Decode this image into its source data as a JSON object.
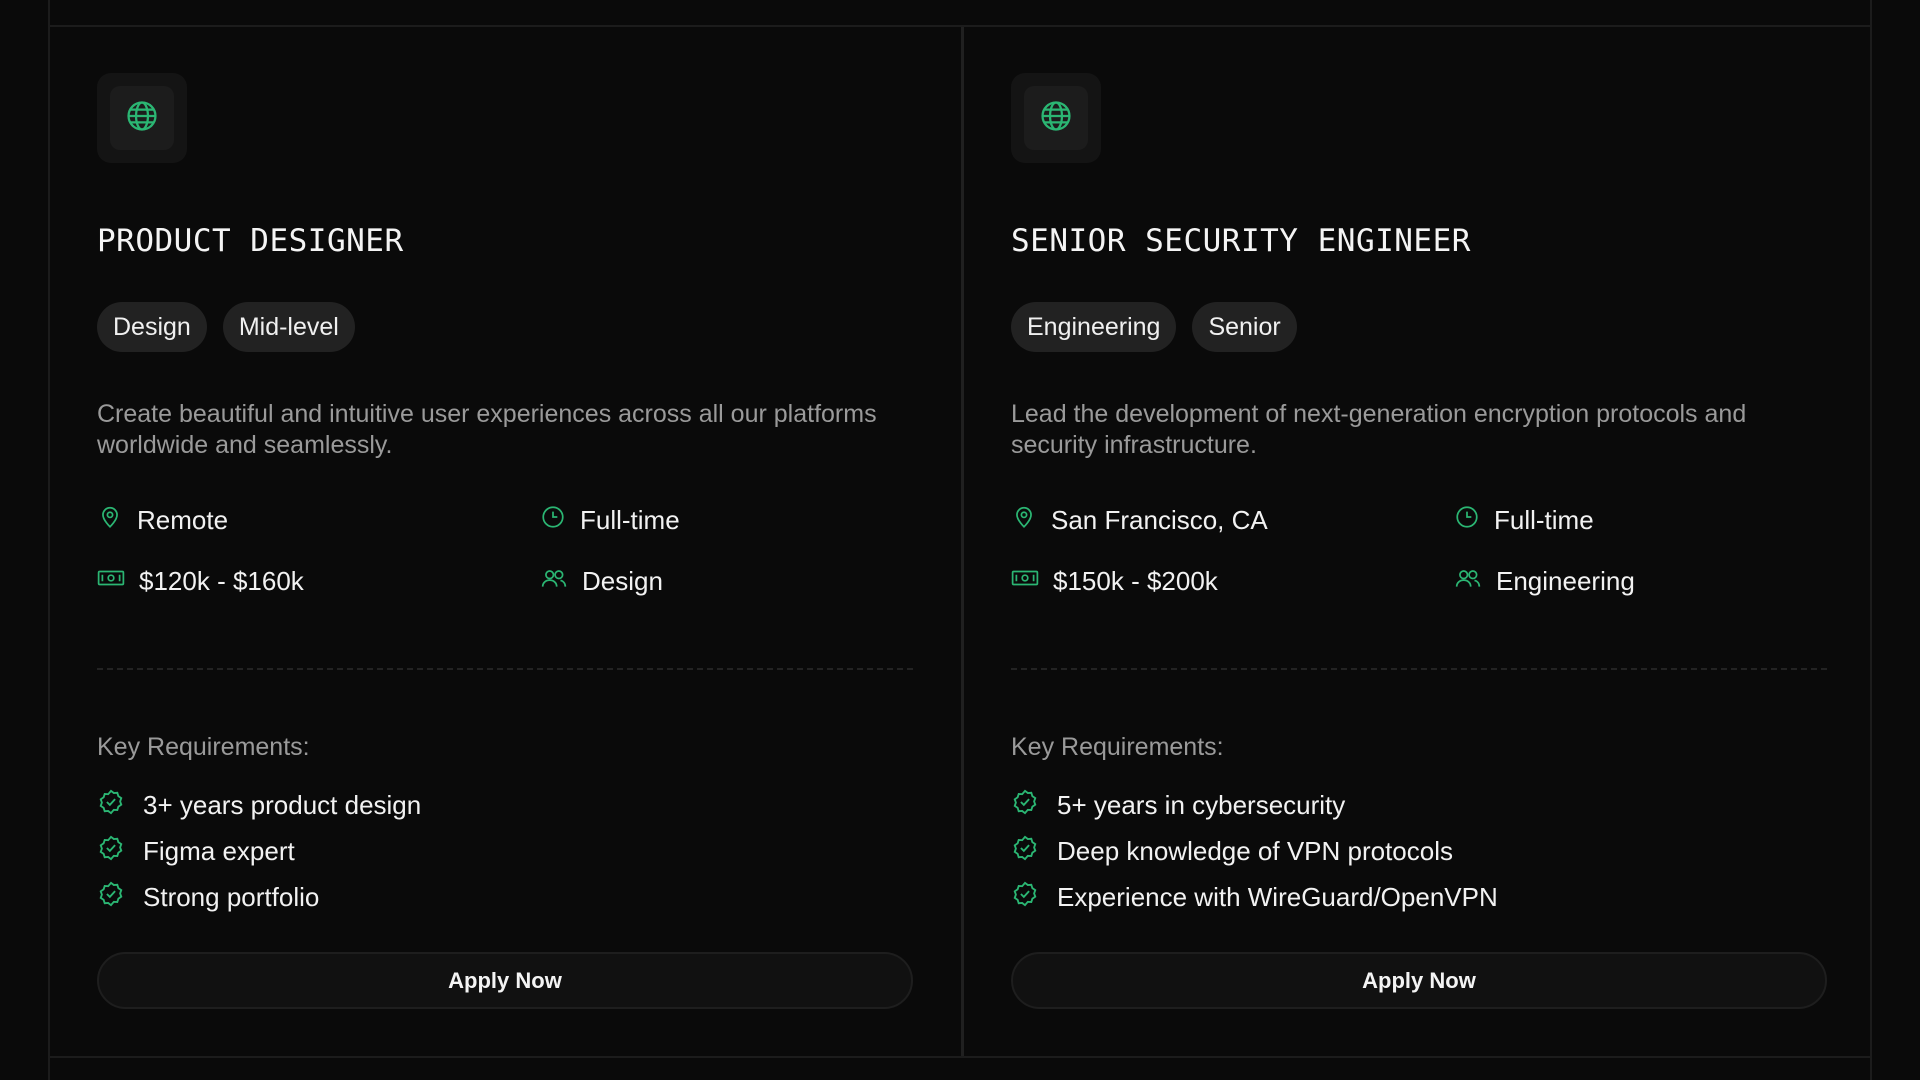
{
  "colors": {
    "accent": "#2bb673",
    "background": "#0a0a0a",
    "muted_text": "#9a9a9a"
  },
  "jobs": [
    {
      "icon": "globe-icon",
      "title": "PRODUCT DESIGNER",
      "tags": [
        "Design",
        "Mid-level"
      ],
      "description": "Create beautiful and intuitive user experiences across all our platforms worldwide and seamlessly.",
      "location": "Remote",
      "type": "Full-time",
      "salary": "$120k - $160k",
      "department": "Design",
      "requirements_label": "Key Requirements:",
      "requirements": [
        "3+ years product design",
        "Figma expert",
        "Strong portfolio"
      ],
      "apply_label": "Apply Now"
    },
    {
      "icon": "globe-icon",
      "title": "SENIOR SECURITY ENGINEER",
      "tags": [
        "Engineering",
        "Senior"
      ],
      "description": "Lead the development of next-generation encryption protocols and security infrastructure.",
      "location": "San Francisco, CA",
      "type": "Full-time",
      "salary": "$150k - $200k",
      "department": "Engineering",
      "requirements_label": "Key Requirements:",
      "requirements": [
        "5+ years in cybersecurity",
        "Deep knowledge of VPN protocols",
        "Experience with WireGuard/OpenVPN"
      ],
      "apply_label": "Apply Now"
    }
  ]
}
